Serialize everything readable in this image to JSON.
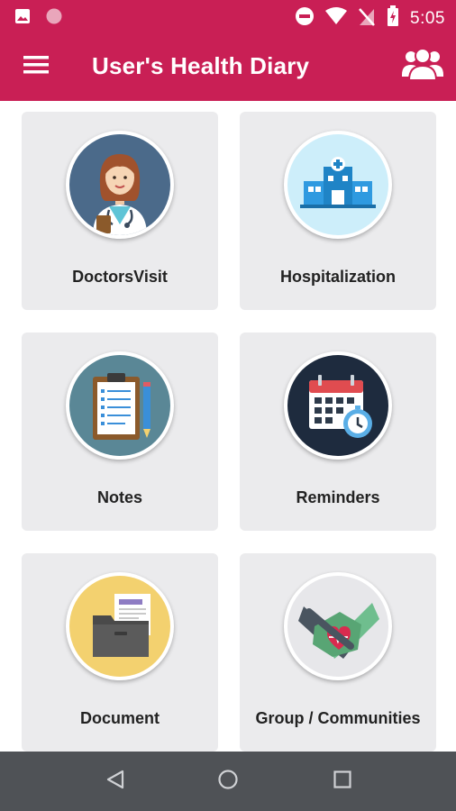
{
  "status_bar": {
    "time": "5:05",
    "icons": [
      "image-icon",
      "circle-notification-icon",
      "do-not-disturb-icon",
      "wifi-icon",
      "no-signal-icon",
      "battery-icon"
    ]
  },
  "app_bar": {
    "title": "User's Health Diary",
    "menu_icon": "menu-icon",
    "group_icon": "group-icon"
  },
  "cards": [
    {
      "label": "DoctorsVisit",
      "icon": "doctor-icon",
      "circle_color": "#4b6a8a"
    },
    {
      "label": "Hospitalization",
      "icon": "hospital-icon",
      "circle_color": "#cdeefa"
    },
    {
      "label": "Notes",
      "icon": "clipboard-notes-icon",
      "circle_color": "#5a8796"
    },
    {
      "label": "Reminders",
      "icon": "calendar-reminder-icon",
      "circle_color": "#1e2b3e"
    },
    {
      "label": "Document",
      "icon": "document-folder-icon",
      "circle_color": "#f3d16f"
    },
    {
      "label": "Group / Communities",
      "icon": "hands-heart-icon",
      "circle_color": "#e7e7ea"
    }
  ],
  "nav_bar": {
    "icons": [
      "back-icon",
      "home-icon",
      "recents-icon"
    ]
  },
  "colors": {
    "primary": "#c91f55",
    "card_background": "#ebebed",
    "nav_bar": "#4f5256"
  }
}
